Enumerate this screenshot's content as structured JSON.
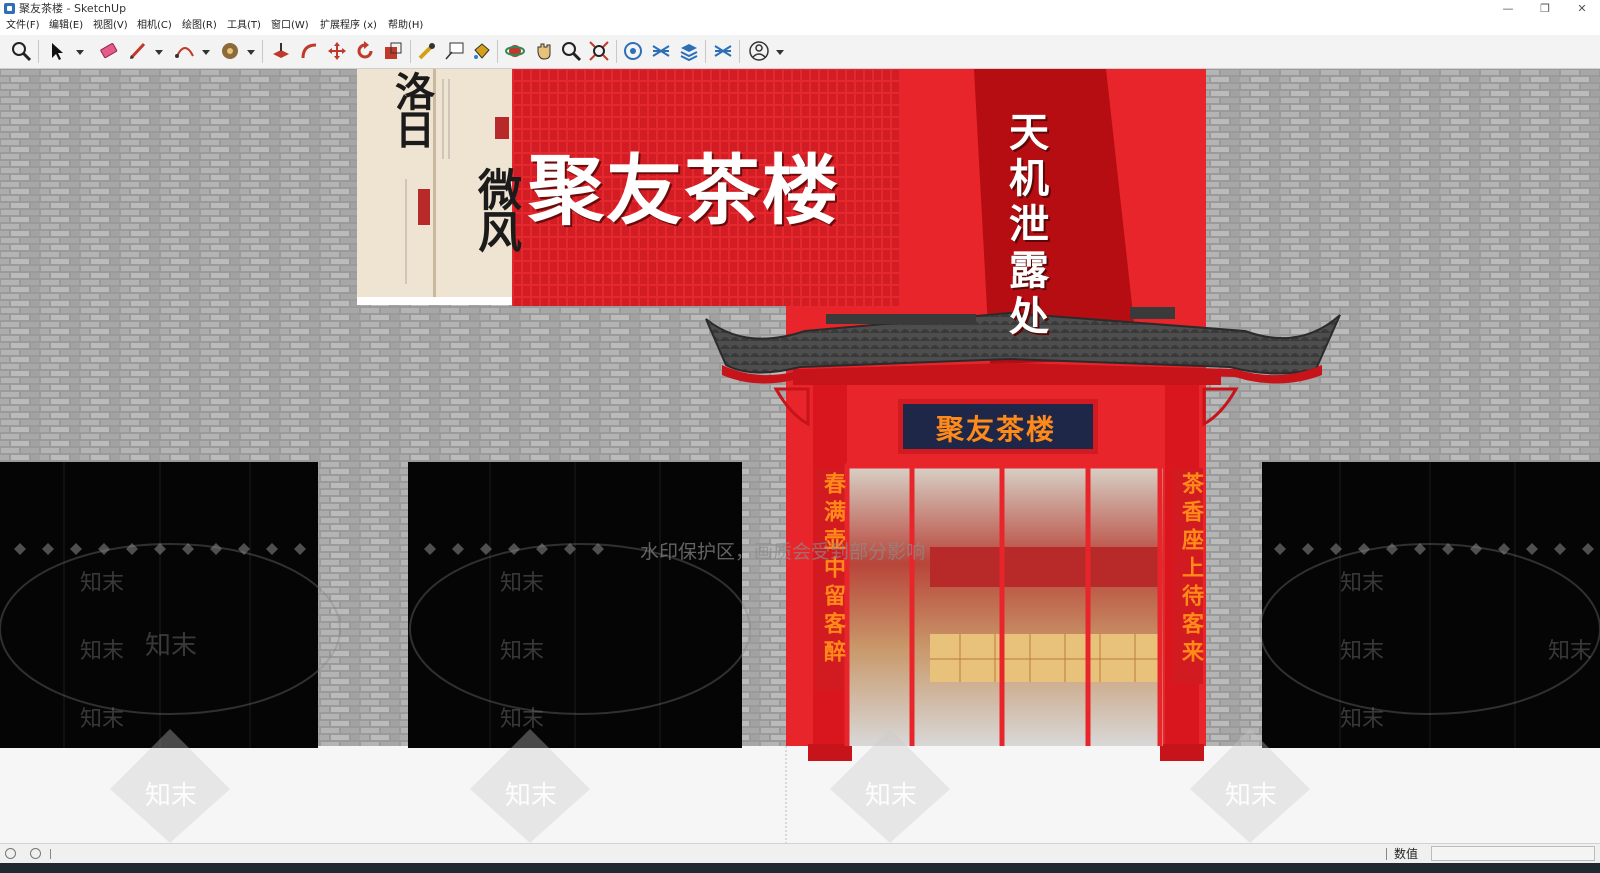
{
  "window": {
    "title": "聚友茶楼 - SketchUp",
    "controls": {
      "minimize": "—",
      "restore": "❐",
      "close": "✕"
    }
  },
  "menu": {
    "items": [
      "文件(F)",
      "编辑(E)",
      "视图(V)",
      "相机(C)",
      "绘图(R)",
      "工具(T)",
      "窗口(W)",
      "扩展程序 (x)",
      "帮助(H)"
    ]
  },
  "toolbar": {
    "tools": [
      "zoom-icon",
      "select-arrow-icon",
      "eraser-icon",
      "pencil-icon",
      "arc-icon",
      "paint-bucket-icon",
      "push-pull-icon",
      "follow-me-icon",
      "move-icon",
      "rotate-icon",
      "scale-icon",
      "tape-measure-icon",
      "text-label-icon",
      "paint-icon",
      "orbit-icon",
      "pan-icon",
      "zoom-window-icon",
      "zoom-extents-icon",
      "warehouse-icon",
      "extension-warehouse-icon",
      "layers-icon",
      "components-icon",
      "account-icon"
    ]
  },
  "scene": {
    "main_sign": "聚友茶楼",
    "vertical_banner": "天机泄露处",
    "door_plaque": "聚友茶楼",
    "couplet_left": "春满壶中留客醉",
    "couplet_right": "茶香座上待客来",
    "calligraphy_1": "洛日",
    "calligraphy_2": "微风",
    "watermark_banner": "水印保护区，画质会受到部分影响",
    "watermark_brand": "知末",
    "colors": {
      "red": "#e8252b",
      "dark_red": "#b50d12",
      "roof": "#4a4a4a",
      "wall": "#9c9c9c",
      "plaque_bg": "#1e2747",
      "couplet_text": "#ff8a1a"
    }
  },
  "status": {
    "measurements_label": "数值",
    "measurements_value": ""
  }
}
